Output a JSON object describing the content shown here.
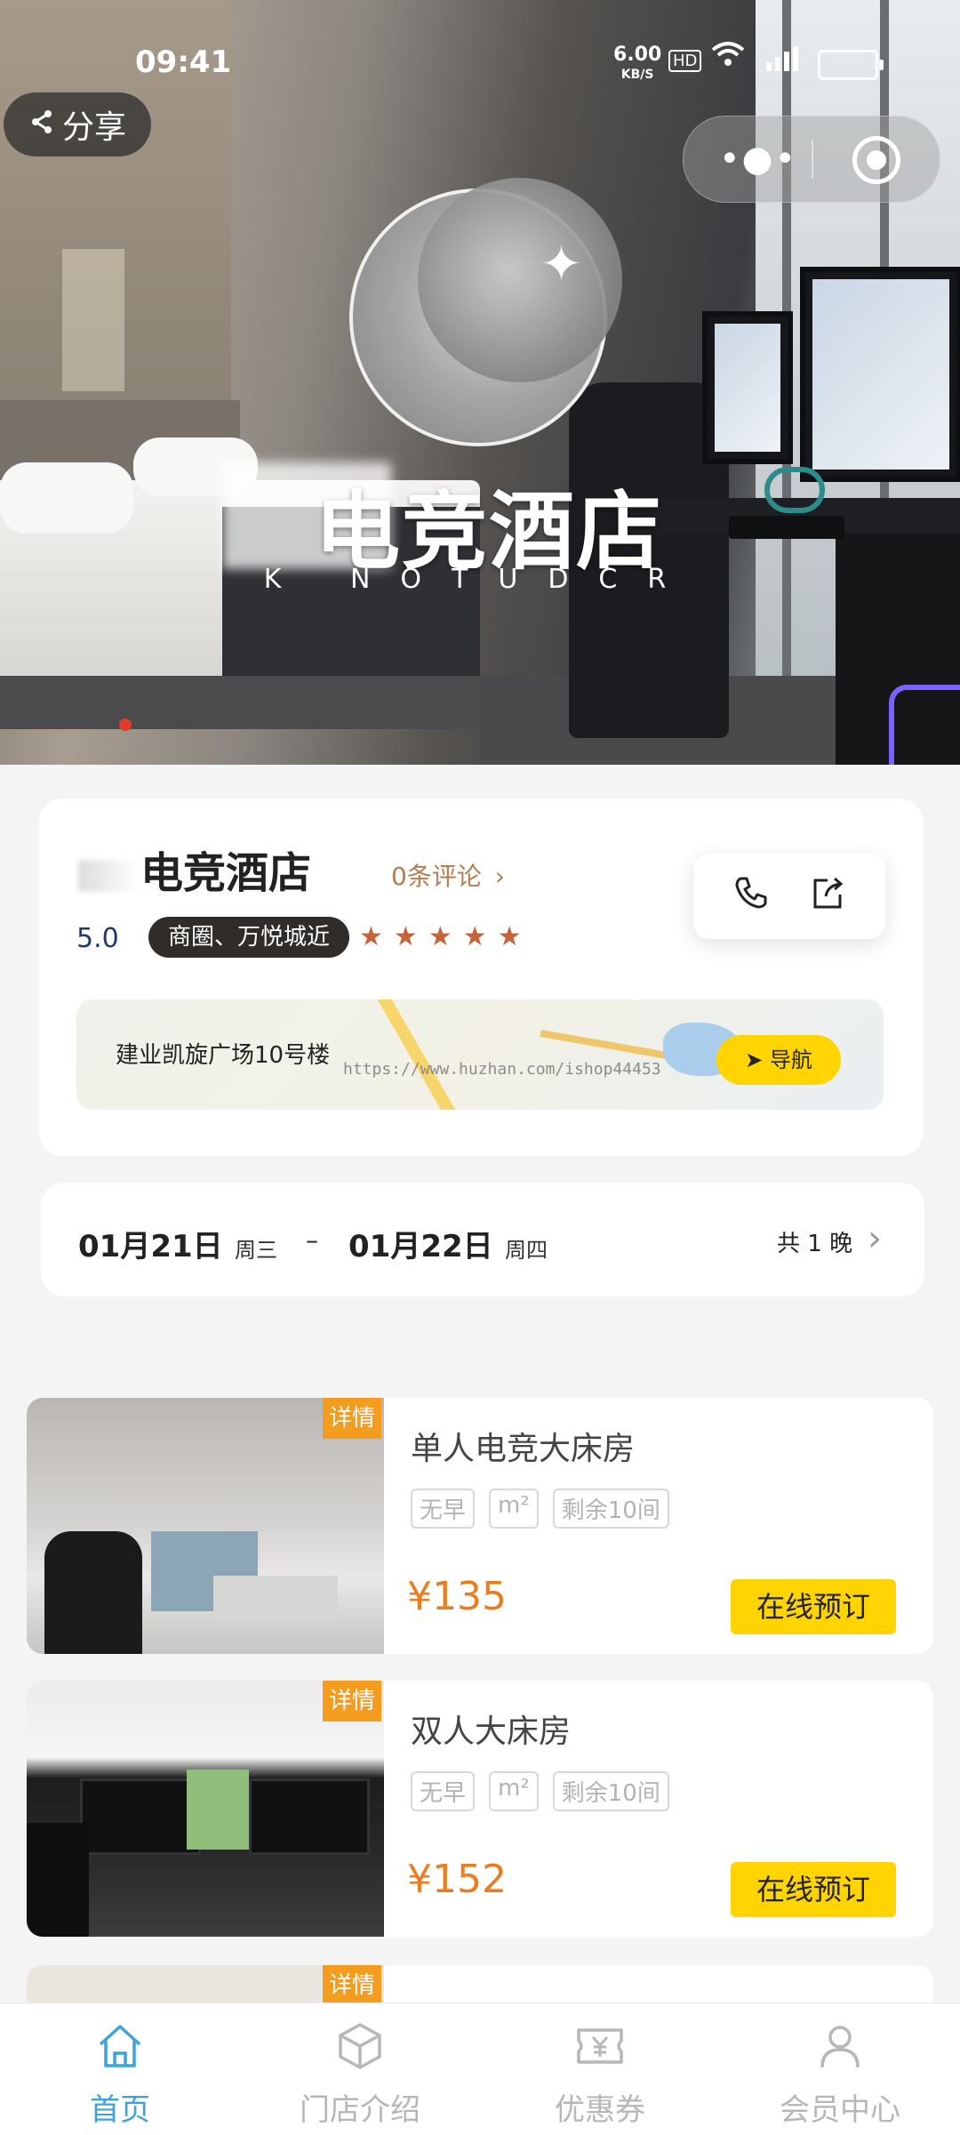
{
  "status_bar": {
    "time": "09:41",
    "net_speed": "6.00",
    "net_unit": "KB/S",
    "hd": "HD"
  },
  "hero": {
    "share_label": "分享",
    "logo_title": "电竞酒店",
    "logo_subtitle": "K NOTUDCR",
    "carousel_active_index": 0
  },
  "hotel": {
    "name": "电竞酒店",
    "reviews_label": "0条评论",
    "score": "5.0",
    "tag": "商圈、万悦城近",
    "rating_stars": 5,
    "address": "建业凯旋广场10号楼",
    "map_watermark": "https://www.huzhan.com/ishop44453",
    "navigate_label": "导航"
  },
  "stay": {
    "checkin_date": "01月21日",
    "checkin_weekday": "周三",
    "separator": "–",
    "checkout_date": "01月22日",
    "checkout_weekday": "周四",
    "nights_label": "共 1 晚"
  },
  "rooms": [
    {
      "detail_label": "详情",
      "name": "单人电竞大床房",
      "chips": [
        "无早",
        "m²",
        "剩余10间"
      ],
      "price": "¥135",
      "book_label": "在线预订"
    },
    {
      "detail_label": "详情",
      "name": "双人大床房",
      "chips": [
        "无早",
        "m²",
        "剩余10间"
      ],
      "price": "¥152",
      "book_label": "在线预订"
    },
    {
      "detail_label": "详情",
      "name": ""
    }
  ],
  "tabs": [
    {
      "label": "首页",
      "icon": "home-icon",
      "active": true
    },
    {
      "label": "门店介绍",
      "icon": "box-icon",
      "active": false
    },
    {
      "label": "优惠券",
      "icon": "coupon-icon",
      "active": false
    },
    {
      "label": "会员中心",
      "icon": "user-icon",
      "active": false
    }
  ],
  "colors": {
    "accent_yellow": "#ffd400",
    "price_orange": "#ea7d1d",
    "tab_active": "#3fa2d8",
    "detail_tag": "#f39c1e"
  }
}
